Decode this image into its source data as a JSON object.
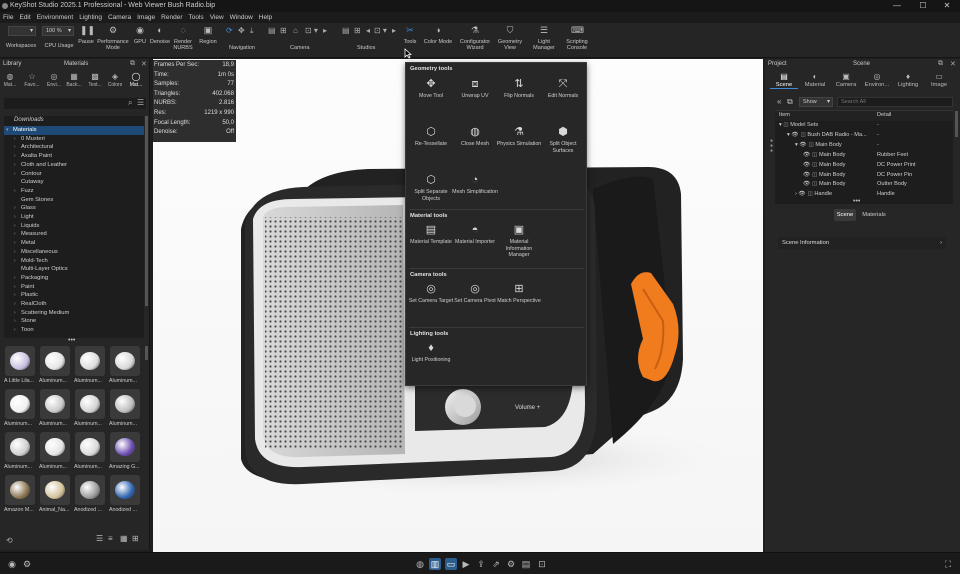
{
  "window": {
    "title": "KeyShot Studio 2025.1 Professional - Web Viewer Bush Radio.bip",
    "min": "—",
    "max": "☐",
    "close": "✕"
  },
  "menu": [
    "File",
    "Edit",
    "Environment",
    "Lighting",
    "Camera",
    "Image",
    "Render",
    "Tools",
    "View",
    "Window",
    "Help"
  ],
  "toolbar": {
    "zoom_value": "100 %",
    "buttons": [
      {
        "label": "Workspaces",
        "icon": "workspaces-icon"
      },
      {
        "label": "CPU Usage",
        "icon": "cpu-usage-icon"
      },
      {
        "label": "Pause",
        "icon": "pause-icon"
      },
      {
        "label": "Performance Mode",
        "icon": "performance-mode-icon"
      },
      {
        "label": "GPU",
        "icon": "gpu-icon"
      },
      {
        "label": "Denoise",
        "icon": "denoise-icon"
      },
      {
        "label": "Render NURBS",
        "icon": "render-nurbs-icon"
      },
      {
        "label": "Region",
        "icon": "region-icon"
      },
      {
        "label": "Tools",
        "icon": "tools-icon"
      },
      {
        "label": "Color Mode",
        "icon": "color-mode-icon"
      },
      {
        "label": "Configurator Wizard",
        "icon": "configurator-wizard-icon"
      },
      {
        "label": "Geometry View",
        "icon": "geometry-view-icon"
      },
      {
        "label": "Light Manager",
        "icon": "light-manager-icon"
      },
      {
        "label": "Scripting Console",
        "icon": "scripting-console-icon"
      }
    ],
    "groups": {
      "navigation": "Navigation",
      "camera": "Camera",
      "studios": "Studios"
    }
  },
  "left_panel": {
    "library_title": "Library",
    "materials_title": "Materials",
    "tabs": [
      "Mat...",
      "Favo...",
      "Envi...",
      "Back...",
      "Text...",
      "Colors",
      "Mat..."
    ],
    "downloads": "Downloads",
    "tree": [
      {
        "label": "Materials",
        "open": true,
        "selected": true,
        "level": 0
      },
      {
        "label": "0 Musteri",
        "level": 1
      },
      {
        "label": "Architectural",
        "level": 1
      },
      {
        "label": "Axalta Paint",
        "level": 1
      },
      {
        "label": "Cloth and Leather",
        "level": 1
      },
      {
        "label": "Contour",
        "level": 1
      },
      {
        "label": "Cutaway",
        "level": 1,
        "leaf": true
      },
      {
        "label": "Fuzz",
        "level": 1
      },
      {
        "label": "Gem Stones",
        "level": 1,
        "leaf": true
      },
      {
        "label": "Glass",
        "level": 1
      },
      {
        "label": "Light",
        "level": 1
      },
      {
        "label": "Liquids",
        "level": 1
      },
      {
        "label": "Measured",
        "level": 1
      },
      {
        "label": "Metal",
        "level": 1
      },
      {
        "label": "Miscellaneous",
        "level": 1
      },
      {
        "label": "Mold-Tech",
        "level": 1
      },
      {
        "label": "Multi-Layer Optics",
        "level": 1,
        "leaf": true
      },
      {
        "label": "Packaging",
        "level": 1
      },
      {
        "label": "Paint",
        "level": 1
      },
      {
        "label": "Plastic",
        "level": 1
      },
      {
        "label": "RealCloth",
        "level": 1
      },
      {
        "label": "Scattering Medium",
        "level": 1
      },
      {
        "label": "Stone",
        "level": 1
      },
      {
        "label": "Toon",
        "level": 1
      }
    ],
    "thumbs": [
      {
        "label": "A Little Lila...",
        "color": "#c8bfe0"
      },
      {
        "label": "Aluminum...",
        "color": "#e6e6e6"
      },
      {
        "label": "Aluminum...",
        "color": "#dcdcdc"
      },
      {
        "label": "Aluminum...",
        "color": "#d8d8d8"
      },
      {
        "label": "Aluminum...",
        "color": "#f0f0f0"
      },
      {
        "label": "Aluminum...",
        "color": "#c9c9c9"
      },
      {
        "label": "Aluminum...",
        "color": "#d2d2d2"
      },
      {
        "label": "Aluminum...",
        "color": "#bdbdbd"
      },
      {
        "label": "Aluminum...",
        "color": "#cfcfcf"
      },
      {
        "label": "Aluminum...",
        "color": "#e4e4e4"
      },
      {
        "label": "Aluminum...",
        "color": "#d9d9d9"
      },
      {
        "label": "Amazing G...",
        "color": "#6a4bb0"
      },
      {
        "label": "Amazon M...",
        "color": "#8a7550"
      },
      {
        "label": "Animal_Na...",
        "color": "#d4c29a"
      },
      {
        "label": "Anodized ...",
        "color": "#9a9a9a"
      },
      {
        "label": "Anodized ...",
        "color": "#2d63b0"
      }
    ]
  },
  "stats": [
    {
      "k": "Frames Per Sec:",
      "v": "18,9"
    },
    {
      "k": "Time:",
      "v": "1m 0s"
    },
    {
      "k": "Samples:",
      "v": "77"
    },
    {
      "k": "Triangles:",
      "v": "402.068"
    },
    {
      "k": "NURBS:",
      "v": "2.816"
    },
    {
      "k": "Res:",
      "v": "1219 x 990"
    },
    {
      "k": "Focal Length:",
      "v": "50,0"
    },
    {
      "k": "Denoise:",
      "v": "Off"
    }
  ],
  "viewport": {
    "volume_label": "Volume +"
  },
  "tools_menu": {
    "geometry_title": "Geometry tools",
    "geometry": [
      {
        "label": "Move Tool",
        "icon": "move-tool-icon"
      },
      {
        "label": "Unwrap UV",
        "icon": "unwrap-uv-icon"
      },
      {
        "label": "Flip Normals",
        "icon": "flip-normals-icon"
      },
      {
        "label": "Edit Normals",
        "icon": "edit-normals-icon"
      },
      {
        "label": "Re-Tessellate",
        "icon": "re-tessellate-icon"
      },
      {
        "label": "Close Mesh",
        "icon": "close-mesh-icon"
      },
      {
        "label": "Physics Simulation",
        "icon": "physics-simulation-icon"
      },
      {
        "label": "Split Object Surfaces",
        "icon": "split-object-surfaces-icon"
      },
      {
        "label": "Split Separate Objects",
        "icon": "split-separate-objects-icon"
      },
      {
        "label": "Mesh Simplification",
        "icon": "mesh-simplification-icon"
      }
    ],
    "material_title": "Material tools",
    "material": [
      {
        "label": "Material Template",
        "icon": "material-template-icon"
      },
      {
        "label": "Material Importer",
        "icon": "material-importer-icon"
      },
      {
        "label": "Material Information Manager",
        "icon": "material-information-manager-icon"
      }
    ],
    "camera_title": "Camera tools",
    "camera": [
      {
        "label": "Set Camera Target",
        "icon": "set-camera-target-icon"
      },
      {
        "label": "Set Camera Pivot",
        "icon": "set-camera-pivot-icon"
      },
      {
        "label": "Match Perspective",
        "icon": "match-perspective-icon"
      }
    ],
    "lighting_title": "Lighting tools",
    "lighting": [
      {
        "label": "Light Positioning",
        "icon": "light-positioning-icon"
      }
    ]
  },
  "right_panel": {
    "project_title": "Project",
    "scene_title": "Scene",
    "tabs": [
      "Scene",
      "Material",
      "Camera",
      "Environ...",
      "Lighting",
      "Image"
    ],
    "show_label": "Show",
    "search_placeholder": "Search All",
    "col_item": "Item",
    "col_detail": "Detail",
    "rows": [
      {
        "item": "Model Sets",
        "detail": "-",
        "indent": 0
      },
      {
        "item": "Bush DAB Radio - Ma...",
        "detail": "-",
        "indent": 1
      },
      {
        "item": "Main Body",
        "detail": "-",
        "indent": 2
      },
      {
        "item": "Main Body",
        "detail": "Rubber Feet",
        "indent": 3
      },
      {
        "item": "Main Body",
        "detail": "DC Power Print",
        "indent": 3
      },
      {
        "item": "Main Body",
        "detail": "DC Power Pin",
        "indent": 3
      },
      {
        "item": "Main Body",
        "detail": "Outter Body",
        "indent": 3
      },
      {
        "item": "Handle",
        "detail": "Handle",
        "indent": 2
      }
    ],
    "subtabs": [
      "Scene",
      "Materials"
    ],
    "scene_info": "Scene Information"
  }
}
